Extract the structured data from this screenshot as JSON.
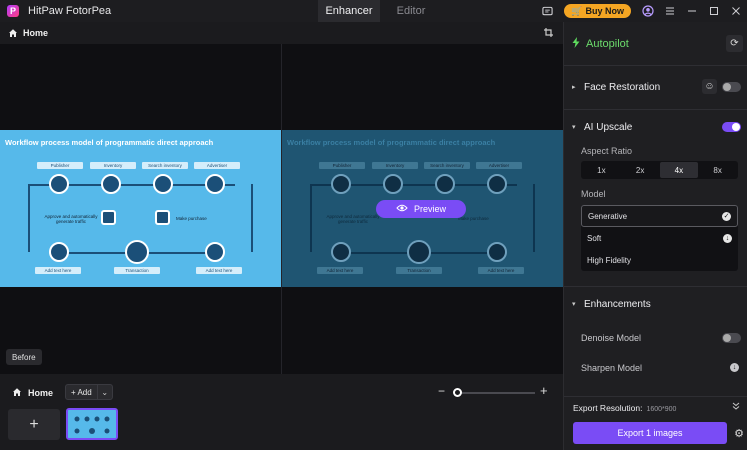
{
  "titlebar": {
    "app_title": "HitPaw FotorPea",
    "tabs": [
      {
        "label": "Enhancer"
      },
      {
        "label": "Editor"
      }
    ],
    "buy_label": "Buy Now"
  },
  "workspace": {
    "home_label": "Home",
    "before_tag": "Before",
    "preview_label": "Preview",
    "slide": {
      "title": "Workflow process model of programmatic direct approach",
      "roles": [
        "Publisher",
        "Inventory",
        "Search inventory",
        "Advertiser"
      ],
      "bottom": [
        "Add text here",
        "Transaction",
        "Add text here"
      ],
      "mid_left": "Approve and automatically generate traffic",
      "mid_right": "Make purchase"
    }
  },
  "bottom": {
    "home_label": "Home",
    "add_label": "+ Add",
    "add_tile_label": "+"
  },
  "panel": {
    "autopilot_label": "Autopilot",
    "face_restoration_label": "Face Restoration",
    "ai_upscale_label": "AI Upscale",
    "aspect_ratio_label": "Aspect Ratio",
    "aspect_options": [
      {
        "label": "1x"
      },
      {
        "label": "2x"
      },
      {
        "label": "4x"
      },
      {
        "label": "8x"
      }
    ],
    "aspect_selected": "4x",
    "model_label": "Model",
    "models": [
      {
        "label": "Generative"
      },
      {
        "label": "Soft"
      },
      {
        "label": "High Fidelity"
      }
    ],
    "model_selected": "Generative",
    "enhancements_label": "Enhancements",
    "denoise_label": "Denoise Model",
    "sharpen_label": "Sharpen Model",
    "export_resolution_label": "Export Resolution:",
    "export_resolution_value": "1600*900",
    "export_button_label": "Export 1 images",
    "face_restoration_on": false,
    "ai_upscale_on": true,
    "denoise_on": false
  },
  "colors": {
    "accent": "#7a4cf5",
    "autopilot": "#6cdc6c",
    "buy": "#f5a623"
  }
}
